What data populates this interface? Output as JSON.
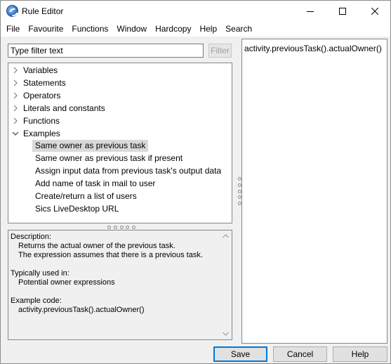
{
  "window": {
    "title": "Rule Editor"
  },
  "menu": [
    "File",
    "Favourite",
    "Functions",
    "Window",
    "Hardcopy",
    "Help",
    "Search"
  ],
  "filter": {
    "placeholder": "Type filter text",
    "button_label": "Filter"
  },
  "tree": {
    "categories": [
      {
        "label": "Variables",
        "expanded": false
      },
      {
        "label": "Statements",
        "expanded": false
      },
      {
        "label": "Operators",
        "expanded": false
      },
      {
        "label": "Literals and constants",
        "expanded": false
      },
      {
        "label": "Functions",
        "expanded": false
      },
      {
        "label": "Examples",
        "expanded": true
      }
    ],
    "examples": [
      "Same owner as previous task",
      "Same owner as previous task if present",
      "Assign input data from previous task's output data",
      "Add name of task in mail to user",
      "Create/return a list of users",
      "Sics LiveDesktop URL"
    ],
    "selected_example": "Same owner as previous task"
  },
  "description": {
    "heading": "Description:",
    "lines": [
      "Returns the actual owner of the previous task.",
      "The expression assumes that there is a previous task."
    ],
    "used_in_heading": "Typically used in:",
    "used_in": "Potential owner expressions",
    "example_heading": "Example code:",
    "example_code": "activity.previousTask().actualOwner()"
  },
  "editor": {
    "content": "activity.previousTask().actualOwner()"
  },
  "buttons": {
    "save": "Save",
    "cancel": "Cancel",
    "help": "Help"
  },
  "colors": {
    "focus_border": "#0078d7",
    "selection": "#d9d9d9"
  }
}
